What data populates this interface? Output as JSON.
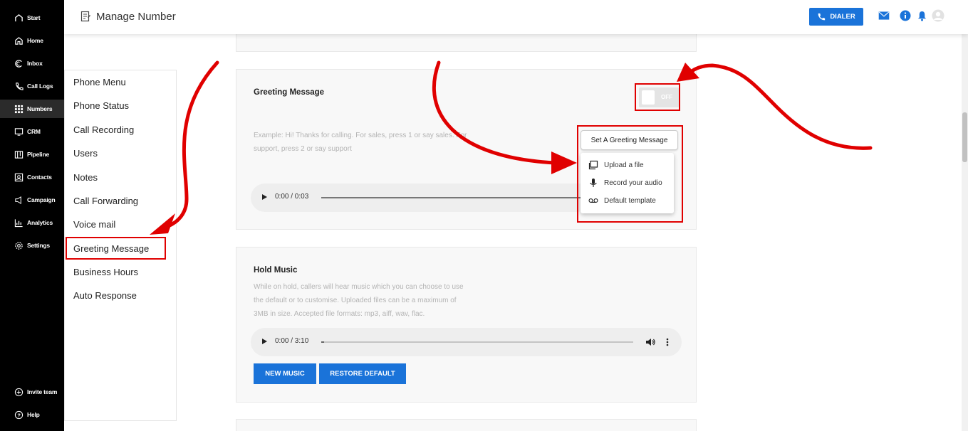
{
  "sidebar": {
    "items": [
      {
        "label": "Start",
        "icon": "start-icon"
      },
      {
        "label": "Home",
        "icon": "home-icon"
      },
      {
        "label": "Inbox",
        "icon": "inbox-icon"
      },
      {
        "label": "Call Logs",
        "icon": "phone-icon"
      },
      {
        "label": "Numbers",
        "icon": "keypad-icon"
      },
      {
        "label": "CRM",
        "icon": "crm-icon"
      },
      {
        "label": "Pipeline",
        "icon": "pipeline-icon"
      },
      {
        "label": "Contacts",
        "icon": "contacts-icon"
      },
      {
        "label": "Campaign",
        "icon": "campaign-icon"
      },
      {
        "label": "Analytics",
        "icon": "analytics-icon"
      },
      {
        "label": "Settings",
        "icon": "gear-icon"
      }
    ],
    "bottom": [
      {
        "label": "Invite team",
        "icon": "plus-circle-icon"
      },
      {
        "label": "Help",
        "icon": "help-icon"
      }
    ],
    "active": "Numbers"
  },
  "header": {
    "title": "Manage Number",
    "dialer_label": "DIALER"
  },
  "submenu": {
    "items": [
      "Phone Menu",
      "Phone Status",
      "Call Recording",
      "Users",
      "Notes",
      "Call Forwarding",
      "Voice mail",
      "Greeting Message",
      "Business Hours",
      "Auto Response"
    ],
    "selected": "Greeting Message"
  },
  "greeting": {
    "title": "Greeting Message",
    "toggle_label": "OFF",
    "placeholder_line1": "Example: Hi! Thanks for calling. For sales, press 1 or say sales. For",
    "placeholder_line2": "support, press 2 or say support",
    "audio_time": "0:00 / 0:03",
    "set_button": "Set A Greeting Message",
    "options": [
      {
        "label": "Upload a file",
        "icon": "upload-file-icon"
      },
      {
        "label": "Record your audio",
        "icon": "microphone-icon"
      },
      {
        "label": "Default template",
        "icon": "voicemail-icon"
      }
    ]
  },
  "hold_music": {
    "title": "Hold Music",
    "desc_line1": "While on hold, callers will hear music which you can choose to use",
    "desc_line2": "the default or to customise. Uploaded files can be a maximum of",
    "desc_line3": "3MB in size. Accepted file formats: mp3, aiff, wav, flac.",
    "audio_time": "0:00 / 3:10",
    "new_music": "NEW MUSIC",
    "restore_default": "RESTORE DEFAULT"
  },
  "colors": {
    "accent": "#1a73d9",
    "highlight": "#e00000"
  }
}
